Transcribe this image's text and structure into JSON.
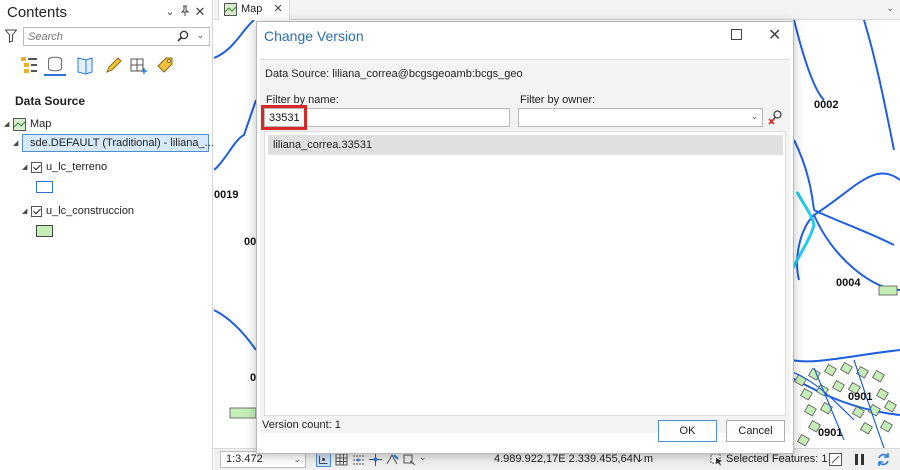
{
  "contents_pane": {
    "title": "Contents",
    "search": {
      "placeholder": "Search"
    },
    "section_heading": "Data Source",
    "tree": {
      "map": "Map",
      "datasource": "sde.DEFAULT (Traditional) - liliana_...",
      "layers": [
        {
          "name": "u_lc_terreno",
          "swatch_fill": "#ffffff",
          "swatch_stroke": "#2f6fd8"
        },
        {
          "name": "u_lc_construccion",
          "swatch_fill": "#c6efb8",
          "swatch_stroke": "#444444"
        }
      ]
    }
  },
  "tab": {
    "label": "Map"
  },
  "map_labels": [
    "0002",
    "0019",
    "00",
    "0004",
    "0",
    "0901",
    "0901"
  ],
  "statusbar": {
    "scale": "1:3.472",
    "coordinates": "4.989.922,17E 2.339.455,64N m",
    "selected_features": "Selected Features: 1"
  },
  "dialog": {
    "title": "Change Version",
    "data_source": "Data Source:  liliana_correa@bcgsgeoamb:bcgs_geo",
    "filter_by_name_label": "Filter by name:",
    "filter_by_name_value": "33531",
    "filter_by_owner_label": "Filter by owner:",
    "filter_by_owner_value": "",
    "versions": [
      "liliana_correa.33531"
    ],
    "version_count": "Version count: 1",
    "ok_label": "OK",
    "cancel_label": "Cancel"
  },
  "colors": {
    "accent": "#2a6fb3",
    "highlight_box": "#d92828",
    "map_line": "#1f5fe0",
    "map_highlight_line": "#25c8f0"
  }
}
